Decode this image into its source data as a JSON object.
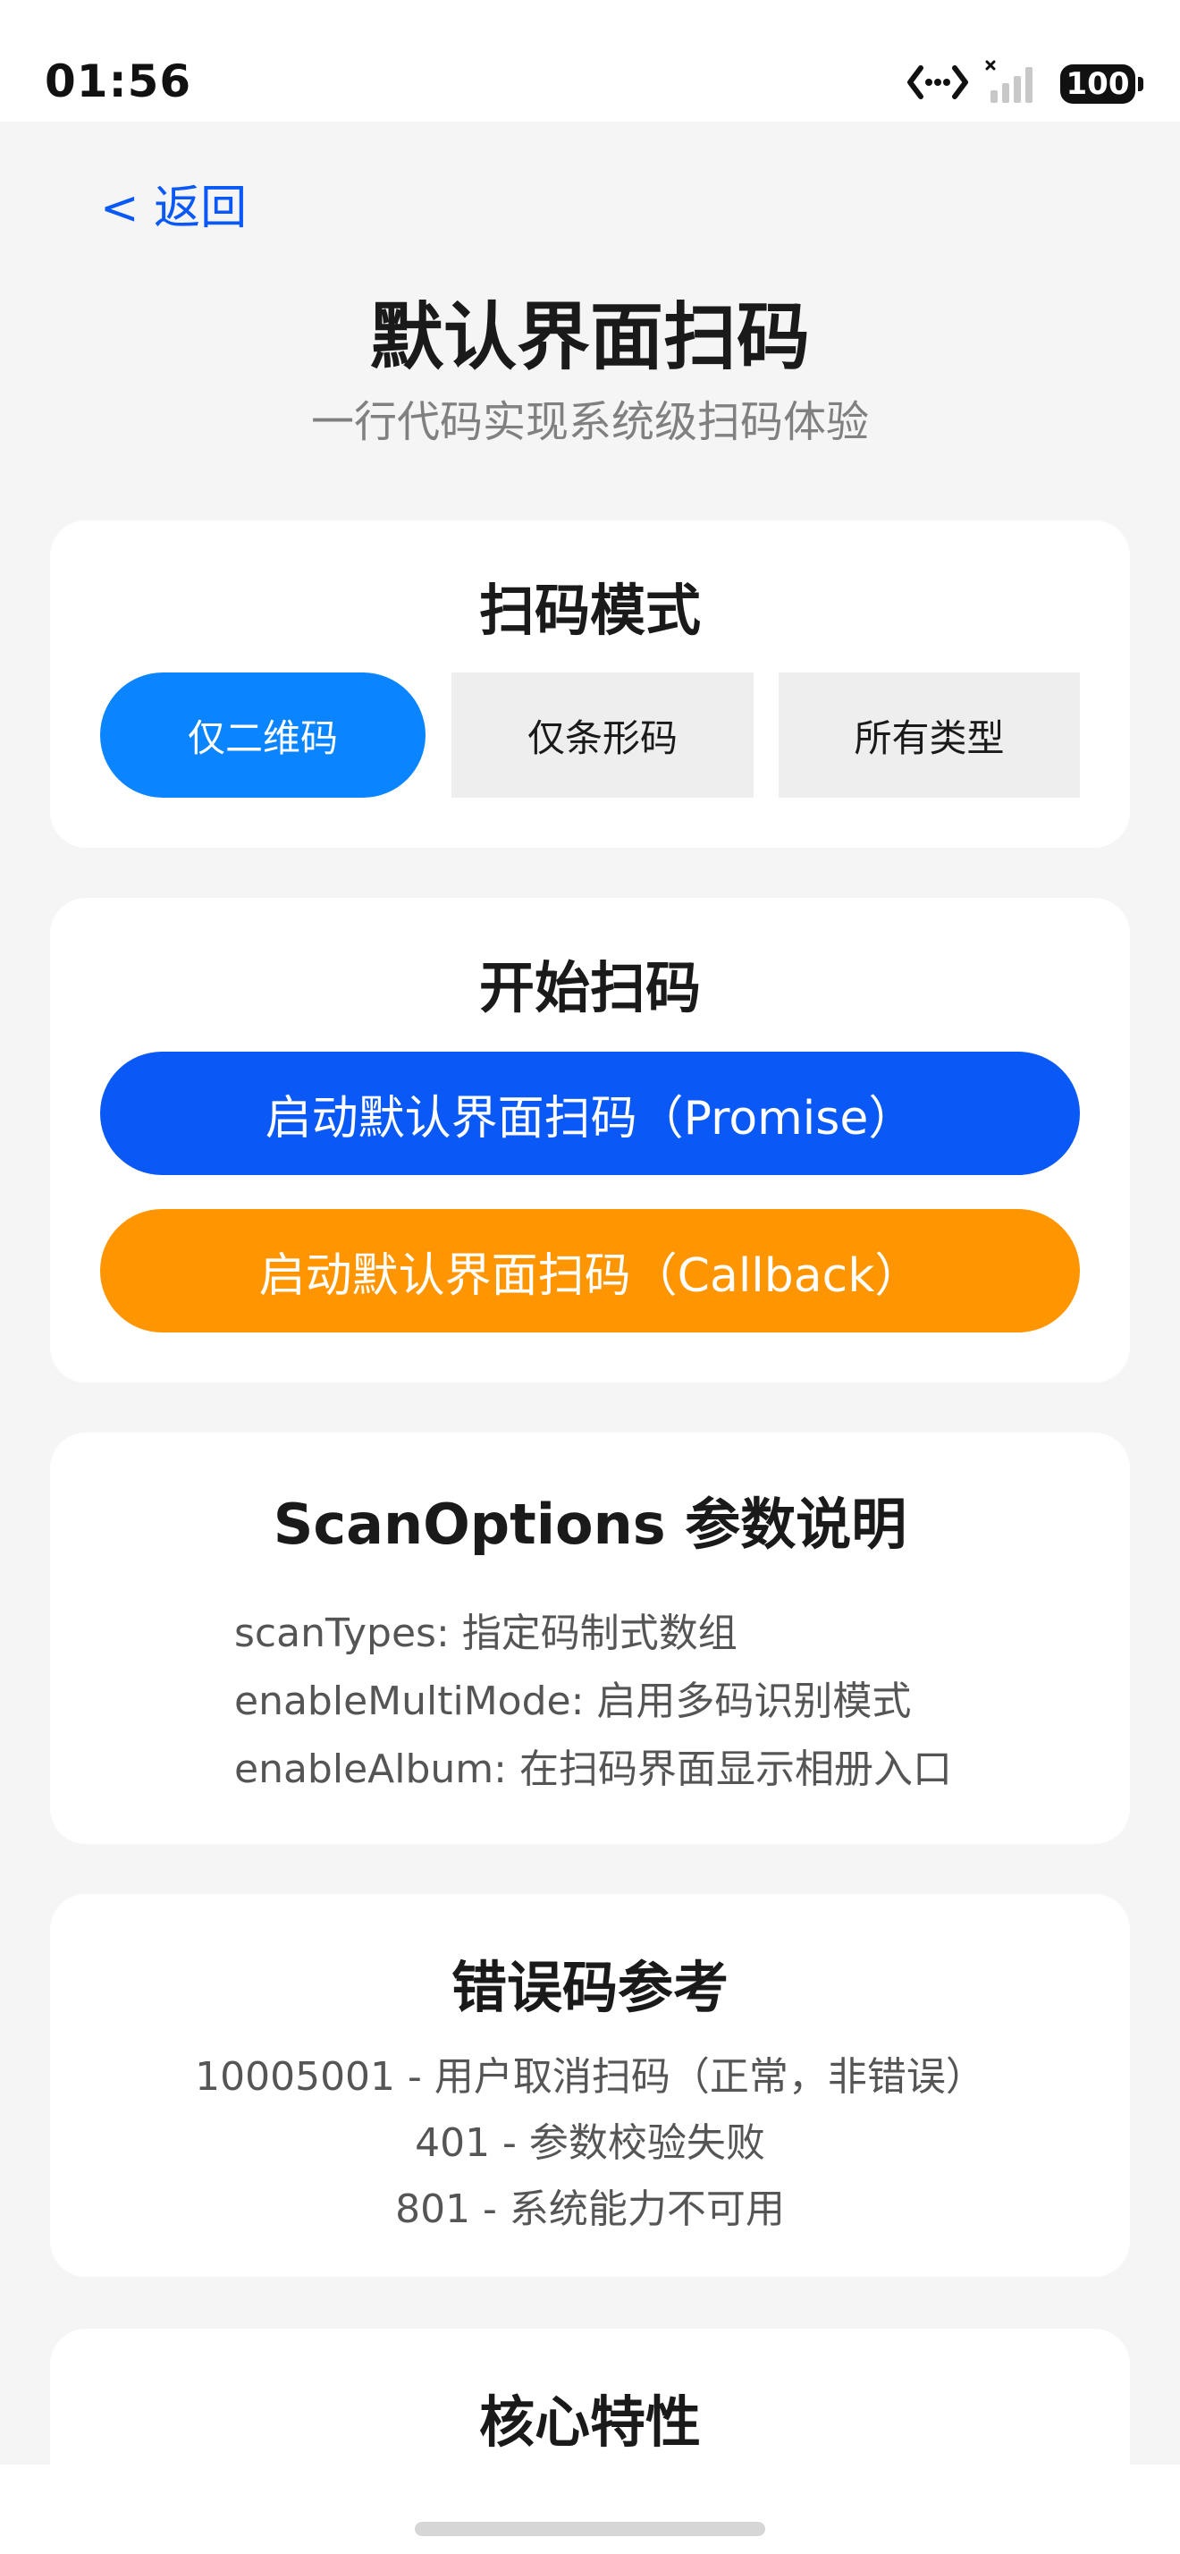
{
  "status_bar": {
    "time": "01:56",
    "battery": "100"
  },
  "nav": {
    "back_label": "< 返回"
  },
  "header": {
    "title": "默认界面扫码",
    "subtitle": "一行代码实现系统级扫码体验"
  },
  "scan_mode": {
    "title": "扫码模式",
    "options": [
      {
        "label": "仅二维码",
        "active": true
      },
      {
        "label": "仅条形码",
        "active": false
      },
      {
        "label": "所有类型",
        "active": false
      }
    ]
  },
  "start_scan": {
    "title": "开始扫码",
    "promise_label": "启动默认界面扫码（Promise）",
    "callback_label": "启动默认界面扫码（Callback）"
  },
  "scan_options": {
    "title": "ScanOptions 参数说明",
    "lines": [
      "scanTypes: 指定码制式数组",
      "enableMultiMode: 启用多码识别模式",
      "enableAlbum: 在扫码界面显示相册入口"
    ]
  },
  "error_codes": {
    "title": "错误码参考",
    "lines": [
      "10005001 - 用户取消扫码（正常，非错误）",
      "401 - 参数校验失败",
      "801 - 系统能力不可用"
    ]
  },
  "core_features": {
    "title": "核心特性"
  },
  "colors": {
    "accent_blue": "#0a59f7",
    "active_mode": "#0a84ff",
    "callback_orange": "#ff9500"
  }
}
